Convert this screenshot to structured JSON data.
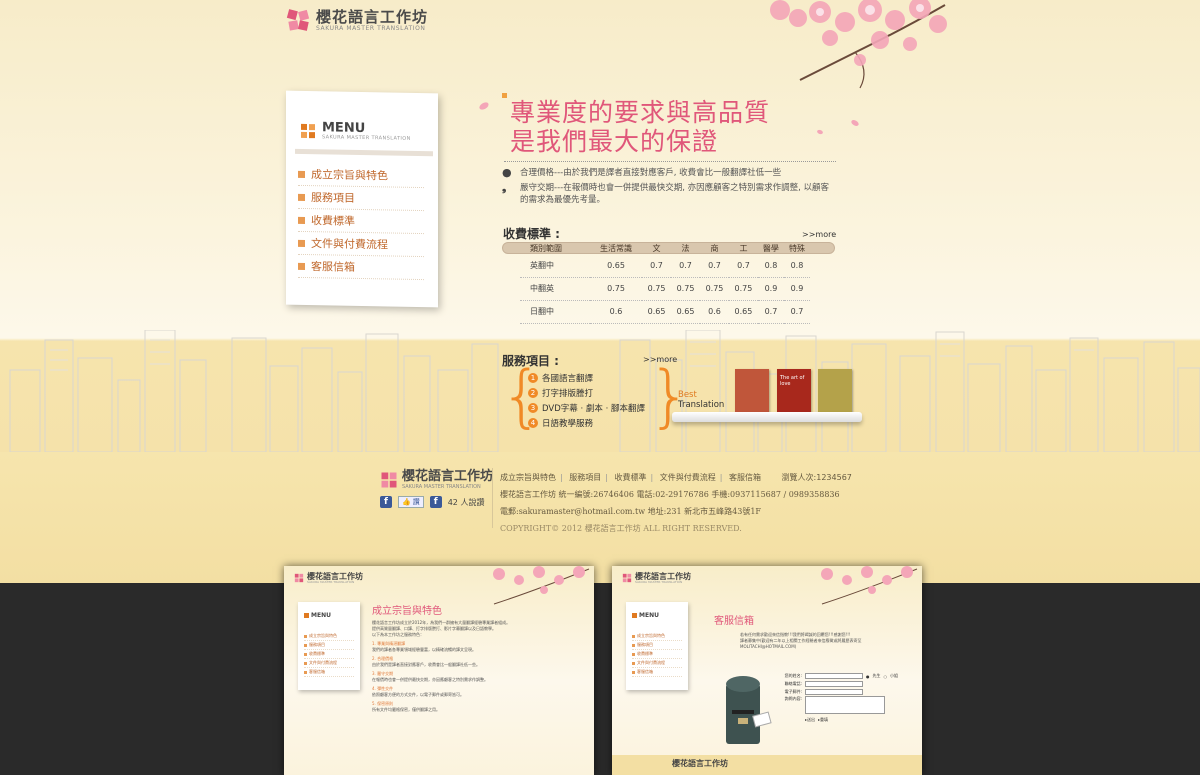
{
  "brand": {
    "name": "櫻花語言工作坊",
    "tagline": "SAKURA MASTER TRANSLATION"
  },
  "menu": {
    "title": "MENU",
    "subtitle": "SAKURA MASTER TRANSLATION",
    "items": [
      "成立宗旨與特色",
      "服務項目",
      "收費標準",
      "文件與付費流程",
      "客服信箱"
    ]
  },
  "hero": {
    "line1": "專業度的要求與高品質",
    "line2": "是我們最大的保證"
  },
  "features": [
    {
      "icon": "dot-bullet",
      "text": "合理價格---由於我們是譯者直接對應客戶, 收費會比一般翻譯社低一些"
    },
    {
      "icon": "comma-bullet",
      "text": "嚴守交期---在報價時也會一併提供最快交期, 亦因應顧客之特別需求作調整, 以顧客的需求為最優先考量。"
    }
  ],
  "pricing": {
    "title": "收費標準 :",
    "more": ">>more",
    "headers": [
      "類別範圍",
      "生活常識",
      "文",
      "法",
      "商",
      "工",
      "醫學",
      "特殊"
    ],
    "rows": [
      {
        "lang": "英翻中",
        "values": [
          "0.65",
          "0.7",
          "0.7",
          "0.7",
          "0.7",
          "0.8",
          "0.8"
        ]
      },
      {
        "lang": "中翻英",
        "values": [
          "0.75",
          "0.75",
          "0.75",
          "0.75",
          "0.75",
          "0.9",
          "0.9"
        ]
      },
      {
        "lang": "日翻中",
        "values": [
          "0.6",
          "0.65",
          "0.65",
          "0.6",
          "0.65",
          "0.7",
          "0.7"
        ]
      }
    ]
  },
  "services": {
    "title": "服務項目 :",
    "more": ">>more",
    "items": [
      "各國語言翻譯",
      "打字排版謄打",
      "DVD字幕 · 劇本 · 腳本翻譯",
      "日語教學服務"
    ],
    "shelf_best": "Best",
    "shelf_translation": "Translation",
    "book_title": "The art of love"
  },
  "footer": {
    "nav": [
      "成立宗旨與特色",
      "服務項目",
      "收費標準",
      "文件與付費流程",
      "客服信箱"
    ],
    "visitors": "瀏覽人次:1234567",
    "line2": "櫻花語言工作坊 統一編號:26746406 電話:02-29176786 手機:0937115687 / 0989358836",
    "line3": "電郵:sakuramaster@hotmail.com.tw 地址:231 新北市五峰路43號1F",
    "copyright": "COPYRIGHT© 2012 櫻花語言工作坊 ALL RIGHT RESERVED.",
    "fb_like": "讚",
    "fb_count": "42 人說讚"
  },
  "thumb1": {
    "heading": "成立宗旨與特色",
    "body1": "櫻花語言工作坊成立於2012年，為我們一群擁有大量翻譯經驗專業譯者組成。",
    "body2": "提供高質量翻譯、口譯、打字排版謄打、影片字幕翻譯以及日語教學。",
    "body3": "以下為本工作坊之服務特色：",
    "s1": "1. 專業與精湛翻譯",
    "s1t": "我們的譯者各專業領域經驗豐富，以精確流暢的譯文呈現。",
    "s2": "2. 合理價格",
    "s2t": "由於我們是譯者直接對應客戶，收費會比一般翻譯社低一些。",
    "s3": "3. 嚴守交期",
    "s3t": "在報價時也會一併提供最快交期，亦因應顧客之特別需求作調整。",
    "s4": "4. 彈性交件",
    "s4t": "依照顧客方便的方式交件，以電子郵件或郵寄皆可。",
    "s5": "5. 保密原則",
    "s5t": "所有文件均嚴格保密，僅供翻譯之用。"
  },
  "thumb2": {
    "heading": "客服信箱",
    "intro1": "若有任何需求歡迎來信指教!!!我們將竭誠的回覆您!!!感謝您!!!",
    "intro2": "譯者募集中(歡迎有二年以上相關工作經驗者來信應徵或將履歷表寄至MOLITACHI@HOTMAIL.COM)",
    "labels": [
      "您的姓名:",
      "聯絡電話:",
      "電子郵件:",
      "詢問內容:"
    ],
    "gender_m": "先生",
    "gender_f": "小姐",
    "send": "送出",
    "clear": "重填"
  },
  "colors": {
    "accent_pink": "#e0577a",
    "accent_orange": "#f08a26",
    "menu_text": "#c0682c",
    "background_cream": "#f7ecc9"
  }
}
